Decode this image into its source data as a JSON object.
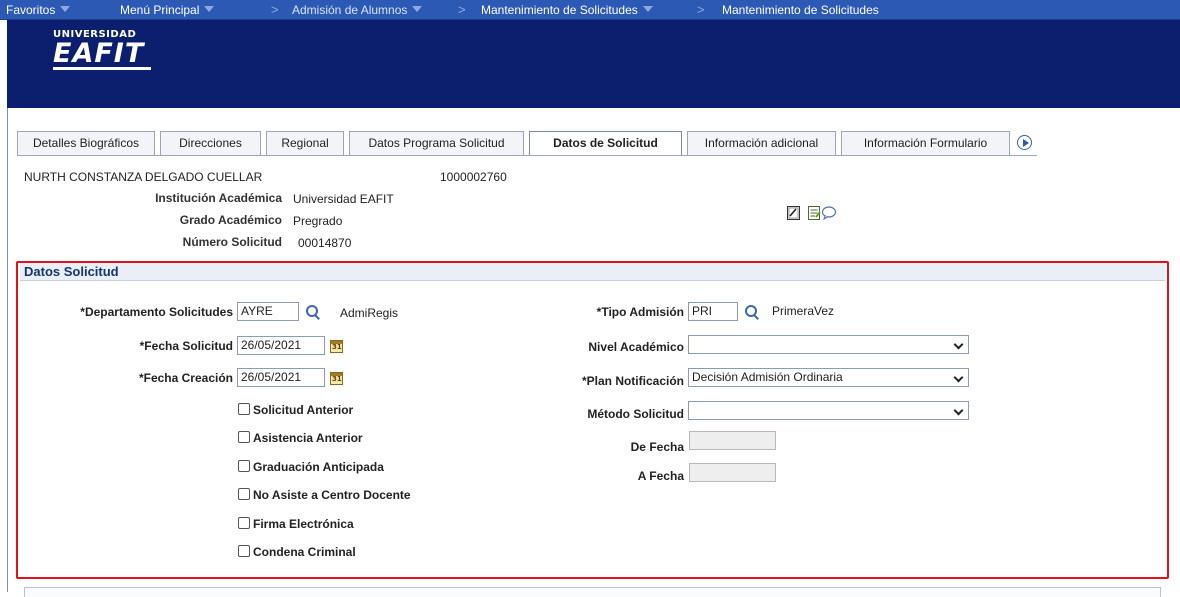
{
  "nav": {
    "favorites": "Favoritos",
    "main_menu": "Menú Principal",
    "separator": ">",
    "crumb1": "Admisión de Alumnos",
    "crumb2": "Mantenimiento de Solicitudes",
    "crumb3": "Mantenimiento de Solicitudes"
  },
  "brand": {
    "line1": "UNIVERSIDAD",
    "line2": "EAFIT"
  },
  "tabs": [
    {
      "label": "Detalles Biográficos"
    },
    {
      "label": "Direcciones"
    },
    {
      "label": "Regional"
    },
    {
      "label": "Datos Programa Solicitud"
    },
    {
      "label": "Datos de Solicitud",
      "active": true
    },
    {
      "label": "Información adicional"
    },
    {
      "label": "Información Formulario"
    }
  ],
  "student": {
    "name": "NURTH CONSTANZA DELGADO CUELLAR",
    "id": "1000002760",
    "institution_label": "Institución Académica",
    "institution_value": "Universidad EAFIT",
    "career_label": "Grado Académico",
    "career_value": "Pregrado",
    "application_label": "Número Solicitud",
    "application_value": "00014870"
  },
  "toolbar_icons": [
    "edit-icon",
    "notes-icon",
    "comment-icon"
  ],
  "section": {
    "title": "Datos Solicitud",
    "left": {
      "dept_label": "*Departamento Solicitudes",
      "dept_value": "AYRE",
      "dept_desc": "AdmiRegis",
      "app_date_label": "*Fecha Solicitud",
      "app_date_value": "26/05/2021",
      "created_label": "*Fecha Creación",
      "created_value": "26/05/2021"
    },
    "checkboxes": [
      {
        "label": "Solicitud Anterior",
        "checked": false
      },
      {
        "label": "Asistencia Anterior",
        "checked": false
      },
      {
        "label": "Graduación Anticipada",
        "checked": false
      },
      {
        "label": "No Asiste a Centro Docente",
        "checked": false
      },
      {
        "label": "Firma Electrónica",
        "checked": false
      },
      {
        "label": "Condena Criminal",
        "checked": false
      }
    ],
    "right": {
      "admit_type_label": "*Tipo Admisión",
      "admit_type_value": "PRI",
      "admit_type_desc": "PrimeraVez",
      "level_label": "Nivel Académico",
      "level_value": "",
      "notif_label": "*Plan Notificación",
      "notif_value": "Decisión Admisión Ordinaria",
      "method_label": "Método Solicitud",
      "method_value": "",
      "from_label": "De Fecha",
      "from_value": "",
      "to_label": "A Fecha",
      "to_value": ""
    }
  },
  "colors": {
    "nav_bg": "#2c59b4",
    "banner_bg": "#0c1f6e",
    "highlight_border": "#e0131c"
  }
}
